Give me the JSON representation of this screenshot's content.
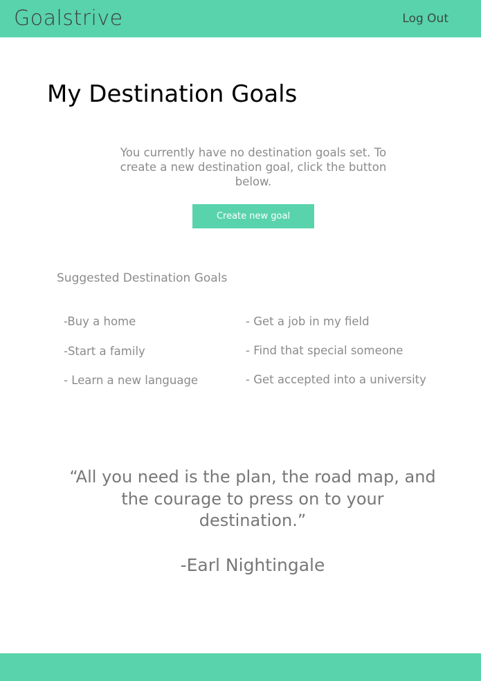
{
  "header": {
    "logo": "Goalstrive",
    "logout_label": "Log Out"
  },
  "main": {
    "title": "My Destination Goals",
    "empty_message": "You currently have no destination goals set. To create a new destination goal, click the button below.",
    "create_button_label": "Create new goal"
  },
  "suggestions": {
    "heading": "Suggested Destination Goals",
    "left": [
      "-Buy a home",
      "-Start a family",
      "- Learn a new language"
    ],
    "right": [
      "- Get a job in my field",
      "- Find that special someone",
      "- Get accepted into a university"
    ]
  },
  "quote": {
    "text": "“All you need is the plan, the road map, and the courage to press on to your destination.”",
    "author": "-Earl Nightingale"
  },
  "colors": {
    "accent": "#59d3ab",
    "muted_text": "#8b8b8b"
  }
}
